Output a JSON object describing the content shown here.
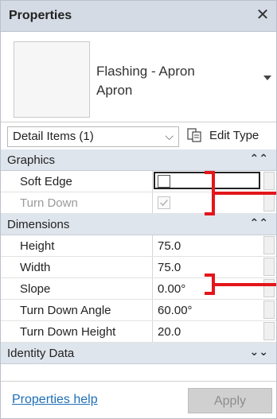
{
  "window": {
    "title": "Properties",
    "close_glyph": "✕"
  },
  "type_selector": {
    "family": "Flashing - Apron",
    "type": "Apron"
  },
  "filter": {
    "selected": "Detail Items (1)",
    "edit_type_label": "Edit Type"
  },
  "categories": [
    {
      "name": "Graphics",
      "toggle": "⌃⌃"
    },
    {
      "name": "Dimensions",
      "toggle": "⌃⌃"
    },
    {
      "name": "Identity Data",
      "toggle": "⌄⌄"
    }
  ],
  "graphics": {
    "soft_edge": {
      "label": "Soft Edge",
      "checked": false
    },
    "turn_down": {
      "label": "Turn Down",
      "checked": true,
      "disabled": true
    }
  },
  "dimensions": [
    {
      "label": "Height",
      "value": "75.0"
    },
    {
      "label": "Width",
      "value": "75.0"
    },
    {
      "label": "Slope",
      "value": "0.00°"
    },
    {
      "label": "Turn Down Angle",
      "value": "60.00°"
    },
    {
      "label": "Turn Down Height",
      "value": "20.0"
    }
  ],
  "footer": {
    "help_link": "Properties help",
    "apply_label": "Apply"
  },
  "colors": {
    "annotation": "#e3161b",
    "link": "#1e6fb8",
    "category_bg": "#dfe5ec"
  }
}
